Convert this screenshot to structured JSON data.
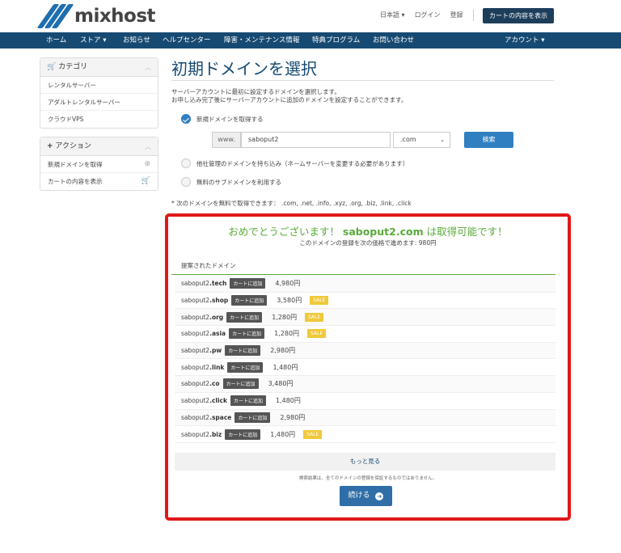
{
  "header": {
    "logo_text": "mixhost",
    "language": "日本語 ▾",
    "login": "ログイン",
    "register": "登録",
    "cart_button": "カートの内容を表示"
  },
  "nav": {
    "items": [
      "ホーム",
      "ストア ▾",
      "お知らせ",
      "ヘルプセンター",
      "障害・メンテナンス情報",
      "特典プログラム",
      "お問い合わせ"
    ],
    "account": "アカウント ▾"
  },
  "sidebar": {
    "categories": {
      "title": "カテゴリ",
      "items": [
        "レンタルサーバー",
        "アダルトレンタルサーバー",
        "クラウドVPS"
      ]
    },
    "actions": {
      "title": "アクション",
      "items": [
        "新規ドメインを取得",
        "カートの内容を表示"
      ]
    }
  },
  "main": {
    "title": "初期ドメインを選択",
    "desc_line1": "サーバーアカウントに最初に設定するドメインを選択します。",
    "desc_line2": "お申し込み完了後にサーバーアカウントに追加のドメインを設定することができます。",
    "options": [
      {
        "label": "新規ドメインを取得する",
        "selected": true
      },
      {
        "label": "他社管理のドメインを持ち込み（ネームサーバーを変更する必要があります）",
        "selected": false
      },
      {
        "label": "無料のサブドメインを利用する",
        "selected": false
      }
    ],
    "www_prefix": "www.",
    "domain_value": "saboput2",
    "tld_value": ".com",
    "search_button": "検索",
    "free_note": "* 次のドメインを無料で取得できます： .com, .net, .info, .xyz, .org, .biz, .link, .click"
  },
  "result": {
    "congrats_prefix": "おめでとうございます！",
    "congrats_domain": "saboput2.com",
    "congrats_suffix": "は取得可能です！",
    "price_note": "このドメインの登録を次の価格で進めます: 980円",
    "suggest_header": "提案されたドメイン",
    "add_label": "カートに追加",
    "sale_label": "SALE",
    "suggestions": [
      {
        "sld": "saboput2",
        "tld": ".tech",
        "price": "4,980円",
        "sale": false
      },
      {
        "sld": "saboput2",
        "tld": ".shop",
        "price": "3,580円",
        "sale": true
      },
      {
        "sld": "saboput2",
        "tld": ".org",
        "price": "1,280円",
        "sale": true
      },
      {
        "sld": "saboput2",
        "tld": ".asia",
        "price": "1,280円",
        "sale": true
      },
      {
        "sld": "saboput2",
        "tld": ".pw",
        "price": "2,980円",
        "sale": false
      },
      {
        "sld": "saboput2",
        "tld": ".link",
        "price": "1,480円",
        "sale": false
      },
      {
        "sld": "saboput2",
        "tld": ".co",
        "price": "3,480円",
        "sale": false
      },
      {
        "sld": "saboput2",
        "tld": ".click",
        "price": "1,480円",
        "sale": false
      },
      {
        "sld": "saboput2",
        "tld": ".space",
        "price": "2,980円",
        "sale": false
      },
      {
        "sld": "saboput2",
        "tld": ".biz",
        "price": "1,480円",
        "sale": true
      }
    ],
    "more_button": "もっと見る",
    "disclaimer": "検索結果は、全てのドメインの登録を保証するものではありません。",
    "continue_button": "続ける"
  },
  "colors": {
    "navy": "#174a72",
    "primary": "#2f7fc1",
    "success": "#5aaa3a",
    "highlight_border": "#e01818",
    "sale": "#f0c93a"
  }
}
